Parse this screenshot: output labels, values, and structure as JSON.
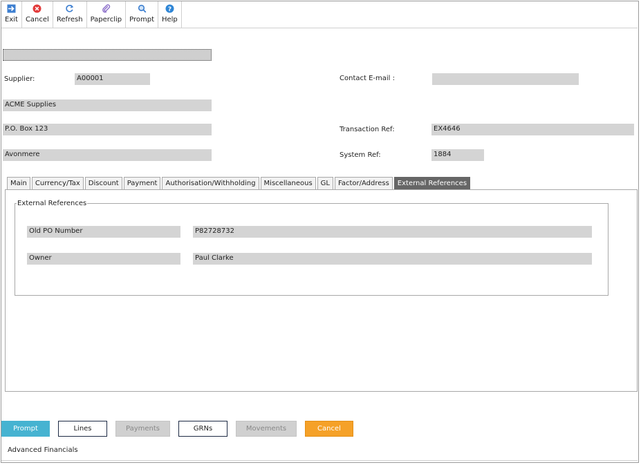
{
  "toolbar": {
    "items": [
      {
        "label": "Exit",
        "icon": "exit-arrow-icon"
      },
      {
        "label": "Cancel",
        "icon": "cancel-x-icon"
      },
      {
        "label": "Refresh",
        "icon": "refresh-icon"
      },
      {
        "label": "Paperclip",
        "icon": "paperclip-icon"
      },
      {
        "label": "Prompt",
        "icon": "magnifier-icon"
      },
      {
        "label": "Help",
        "icon": "help-icon"
      }
    ]
  },
  "header": {
    "supplier_label": "Supplier:",
    "supplier_code": "A00001",
    "supplier_name": "ACME Supplies",
    "address_line1": "P.O. Box 123",
    "address_line2": "Avonmere",
    "contact_email_label": "Contact E-mail :",
    "contact_email": "",
    "transaction_ref_label": "Transaction Ref:",
    "transaction_ref": "EX4646",
    "system_ref_label": "System Ref:",
    "system_ref": "1884"
  },
  "tabs": [
    {
      "label": "Main"
    },
    {
      "label": "Currency/Tax"
    },
    {
      "label": "Discount"
    },
    {
      "label": "Payment"
    },
    {
      "label": "Authorisation/Withholding"
    },
    {
      "label": "Miscellaneous"
    },
    {
      "label": "GL"
    },
    {
      "label": "Factor/Address"
    },
    {
      "label": "External References",
      "active": true
    }
  ],
  "external_references": {
    "legend": "External References",
    "rows": [
      {
        "label": "Old PO Number",
        "value": "P82728732"
      },
      {
        "label": "Owner",
        "value": "Paul Clarke"
      }
    ]
  },
  "buttons": {
    "prompt": "Prompt",
    "lines": "Lines",
    "payments": "Payments",
    "grns": "GRNs",
    "movements": "Movements",
    "cancel": "Cancel"
  },
  "footer": {
    "app_name": "Advanced Financials"
  },
  "colors": {
    "accent": "#46b3d1",
    "cancel": "#f5a128",
    "active_tab": "#666666",
    "field_bg": "#d4d4d4"
  }
}
